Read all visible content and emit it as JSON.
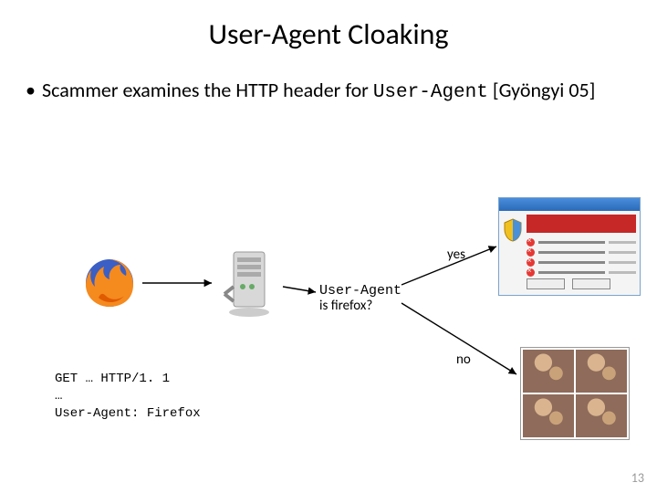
{
  "title": "User-Agent Cloaking",
  "bullet": {
    "prefix": "Scammer examines the HTTP header for ",
    "code": "User-Agent",
    "suffix": " [Gyöngyi 05]"
  },
  "decision": {
    "line1": "User-Agent",
    "line2": "is firefox?"
  },
  "labels": {
    "yes": "yes",
    "no": "no"
  },
  "request": "GET … HTTP/1. 1\n…\nUser-Agent: Firefox",
  "page_number": "13"
}
